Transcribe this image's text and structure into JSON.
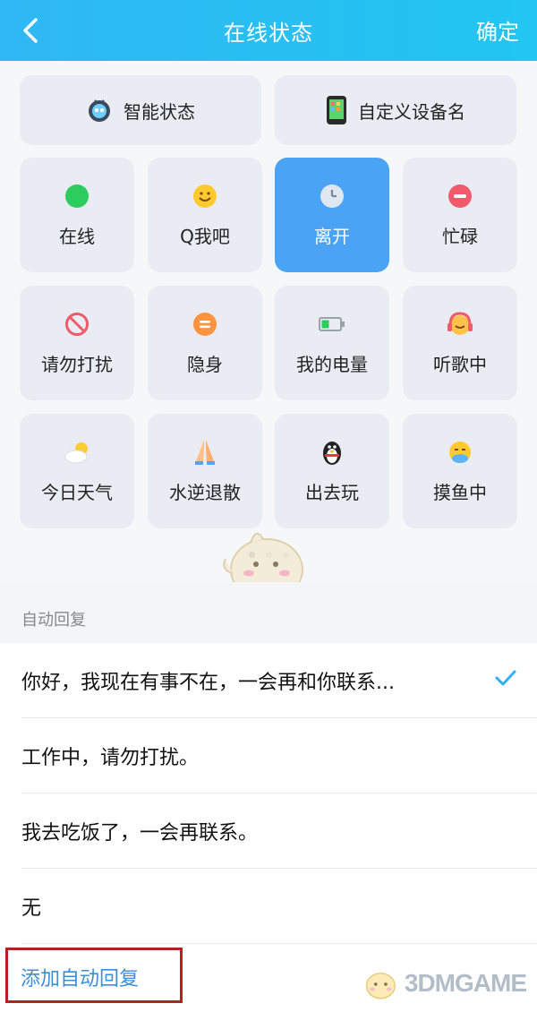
{
  "header": {
    "title": "在线状态",
    "confirm": "确定"
  },
  "top_buttons": [
    {
      "label": "智能状态",
      "icon": "robot-icon"
    },
    {
      "label": "自定义设备名",
      "icon": "phone-icon"
    }
  ],
  "status_tiles": [
    {
      "label": "在线",
      "icon": "online-dot-icon",
      "active": false
    },
    {
      "label": "Q我吧",
      "icon": "smile-icon",
      "active": false
    },
    {
      "label": "离开",
      "icon": "clock-icon",
      "active": true
    },
    {
      "label": "忙碌",
      "icon": "busy-icon",
      "active": false
    },
    {
      "label": "请勿打扰",
      "icon": "no-entry-icon",
      "active": false
    },
    {
      "label": "隐身",
      "icon": "invisible-icon",
      "active": false
    },
    {
      "label": "我的电量",
      "icon": "battery-icon",
      "active": false
    },
    {
      "label": "听歌中",
      "icon": "headphones-icon",
      "active": false
    },
    {
      "label": "今日天气",
      "icon": "weather-icon",
      "active": false
    },
    {
      "label": "水逆退散",
      "icon": "pray-hands-icon",
      "active": false
    },
    {
      "label": "出去玩",
      "icon": "penguin-icon",
      "active": false
    },
    {
      "label": "摸鱼中",
      "icon": "fish-face-icon",
      "active": false
    }
  ],
  "pager": {
    "pages": 3,
    "current": 1
  },
  "auto_reply": {
    "section_label": "自动回复",
    "items": [
      {
        "text": "你好，我现在有事不在，一会再和你联系...",
        "selected": true
      },
      {
        "text": "工作中，请勿打扰。",
        "selected": false
      },
      {
        "text": "我去吃饭了，一会再联系。",
        "selected": false
      },
      {
        "text": "无",
        "selected": false
      }
    ],
    "add_label": "添加自动回复"
  },
  "watermark": {
    "text": "3DMGAME"
  },
  "colors": {
    "header": "#2fb8f5",
    "active_tile": "#4aa3f5",
    "link": "#3a8fd8",
    "highlight_box": "#b22222"
  }
}
